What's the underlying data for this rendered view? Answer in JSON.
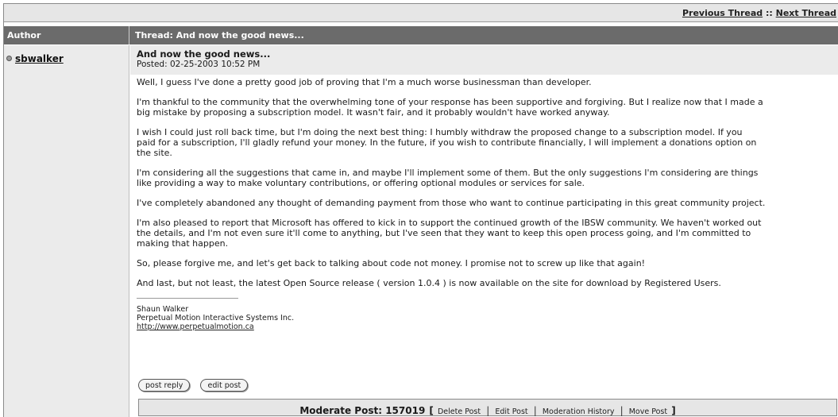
{
  "nav": {
    "previous_thread": "Previous Thread",
    "separator": "::",
    "next_thread": "Next Thread"
  },
  "table_header": {
    "author": "Author",
    "thread": "Thread: And now the good news..."
  },
  "author": {
    "name": "sbwalker"
  },
  "post": {
    "title": "And now the good news...",
    "posted": "Posted: 02-25-2003 10:52 PM",
    "paragraphs": [
      "Well, I guess I've done a pretty good job of proving that I'm a much worse businessman than developer.",
      "I'm thankful to the community that the overwhelming tone of your response has been supportive and forgiving. But I realize now that I made a\nbig mistake by proposing a subscription model. It wasn't fair, and it probably wouldn't have worked anyway.",
      "I wish I could just roll back time, but I'm doing the next best thing: I humbly withdraw the proposed change to a subscription model. If you\npaid for a subscription, I'll gladly refund your money. In the future, if you wish to contribute financially, I will implement a donations option on\nthe site.",
      "I'm considering all the suggestions that came in, and maybe I'll implement some of them. But the only suggestions I'm considering are things\nlike providing a way to make voluntary contributions, or offering optional modules or services for sale.",
      "I've completely abandoned any thought of demanding payment from those who want to continue participating in this great community project.",
      "I'm also pleased to report that Microsoft has offered to kick in to support the continued growth of the IBSW community. We haven't worked out\nthe details, and I'm not even sure it'll come to anything, but I've seen that they want to keep this open process going, and I'm committed to\nmaking that happen.",
      "So, please forgive me, and let's get back to talking about code not money. I promise not to screw up like that again!",
      "And last, but not least, the latest Open Source release ( version 1.0.4 ) is now available on the site for download by Registered Users."
    ],
    "signature": {
      "name": "Shaun Walker",
      "company": "Perpetual Motion Interactive Systems Inc.",
      "url": "http://www.perpetualmotion.ca"
    }
  },
  "buttons": {
    "post_reply": "post reply",
    "edit_post": "edit post"
  },
  "moderation": {
    "label": "Moderate Post: 157019",
    "open_bracket": "[",
    "close_bracket": "]",
    "divider": "|",
    "links": [
      "Delete Post",
      "Edit Post",
      "Moderation History",
      "Move Post"
    ]
  }
}
